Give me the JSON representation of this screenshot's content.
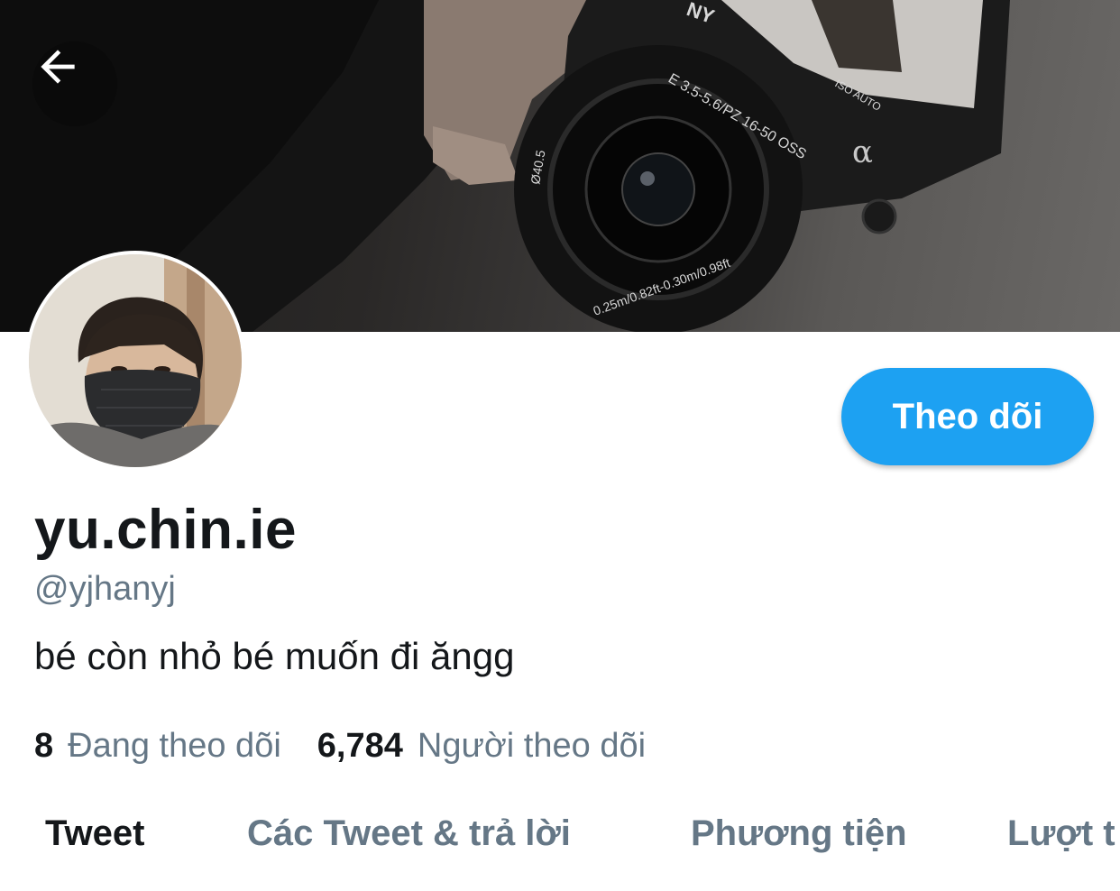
{
  "header": {
    "back_icon": "arrow-left-icon"
  },
  "profile": {
    "display_name": "yu.chin.ie",
    "handle": "@yjhanyj",
    "bio": "bé còn nhỏ bé muốn đi ăngg",
    "follow_label": "Theo dõi"
  },
  "stats": {
    "following_count": "8",
    "following_label": "Đang theo dõi",
    "followers_count": "6,784",
    "followers_label": "Người theo dõi"
  },
  "tabs": [
    {
      "label": "Tweet",
      "active": true
    },
    {
      "label": "Các Tweet & trả lời",
      "active": false
    },
    {
      "label": "Phương tiện",
      "active": false
    },
    {
      "label": "Lượt t",
      "active": false
    }
  ],
  "banner": {
    "lens_text": "E 3.5-5.6/PZ 16-50 OSS",
    "lens_diam": "Ø40.5",
    "lens_focus": "0.25m/0.82ft-0.30m/0.98ft",
    "brand_fragment": "NY",
    "auto_text": "ISO AUTO",
    "alpha": "α"
  },
  "colors": {
    "accent": "#1da1f2",
    "text_primary": "#14171a",
    "text_secondary": "#657786"
  }
}
